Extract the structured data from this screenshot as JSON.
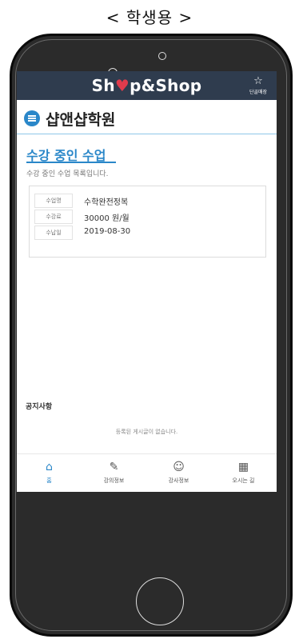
{
  "caption": "< 학생용 >",
  "header": {
    "logo_left": "Sh",
    "logo_pin": "♥",
    "logo_right": "p&Shop",
    "bookmark_icon": "star-icon",
    "bookmark_label": "단골매장"
  },
  "academy": {
    "name": "샵앤샵학원"
  },
  "section": {
    "title": "수강 중인 수업",
    "subtitle": "수강 중인 수업 목록입니다."
  },
  "course": [
    {
      "key": "수업명",
      "value": "수학완전정복"
    },
    {
      "key": "수강료",
      "value": "30000 원/월"
    },
    {
      "key": "수납일",
      "value": "2019-08-30"
    }
  ],
  "notice": {
    "title": "공지사항",
    "empty": "등록된 게시글이 없습니다."
  },
  "nav": [
    {
      "label": "홈",
      "icon": "home-icon",
      "glyph": "⌂",
      "active": true
    },
    {
      "label": "강의정보",
      "icon": "edit-icon",
      "glyph": "✎"
    },
    {
      "label": "강사정보",
      "icon": "profile-icon",
      "glyph": "☺"
    },
    {
      "label": "오시는 길",
      "icon": "map-icon",
      "glyph": "▦"
    }
  ],
  "colors": {
    "topbar": "#2f3c4e",
    "accent": "#2a87c9",
    "pin": "#e03b4c"
  }
}
